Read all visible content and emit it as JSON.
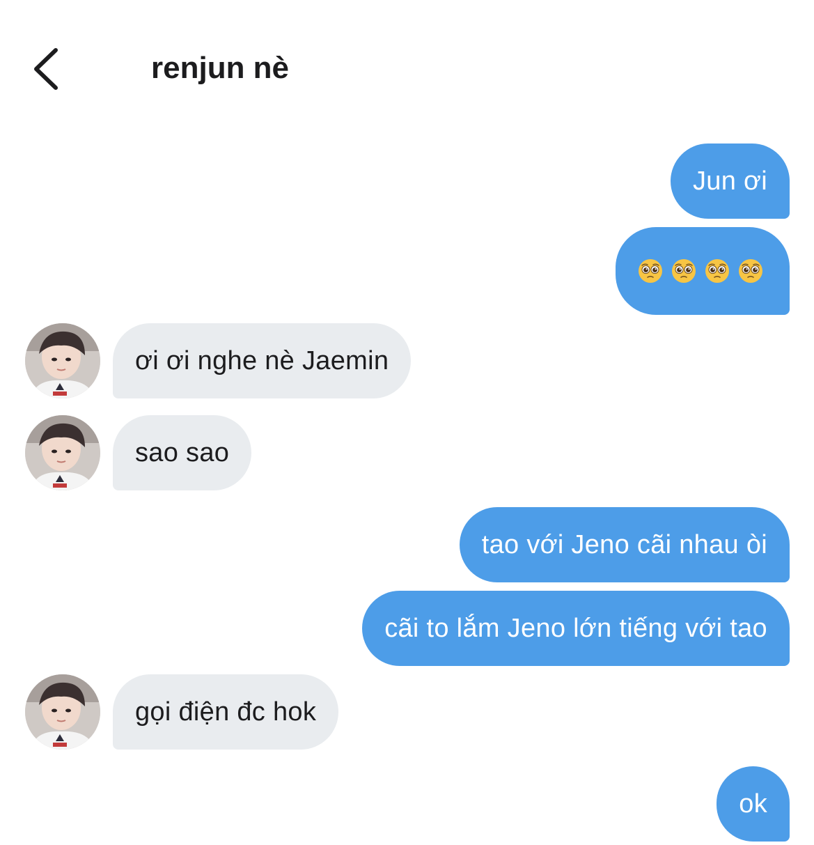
{
  "header": {
    "title": "renjun nè",
    "back_icon": "chevron-left-icon"
  },
  "messages": [
    {
      "side": "sent",
      "text": "Jun ơi"
    },
    {
      "side": "sent",
      "type": "emoji",
      "emoji": [
        "🥺",
        "🥺",
        "🥺",
        "🥺"
      ],
      "icon": "pleading-face-icon"
    },
    {
      "side": "received",
      "text": "ơi ơi nghe nè Jaemin"
    },
    {
      "side": "received",
      "text": "sao sao"
    },
    {
      "side": "sent",
      "text": "tao với Jeno cãi nhau òi"
    },
    {
      "side": "sent",
      "text": "cãi to lắm Jeno lớn tiếng với tao"
    },
    {
      "side": "received",
      "text": "gọi điện đc hok"
    },
    {
      "side": "sent",
      "text": "ok"
    }
  ],
  "colors": {
    "sent_bubble": "#4d9de8",
    "received_bubble": "#e9ecef",
    "text_dark": "#1c1c1e"
  }
}
